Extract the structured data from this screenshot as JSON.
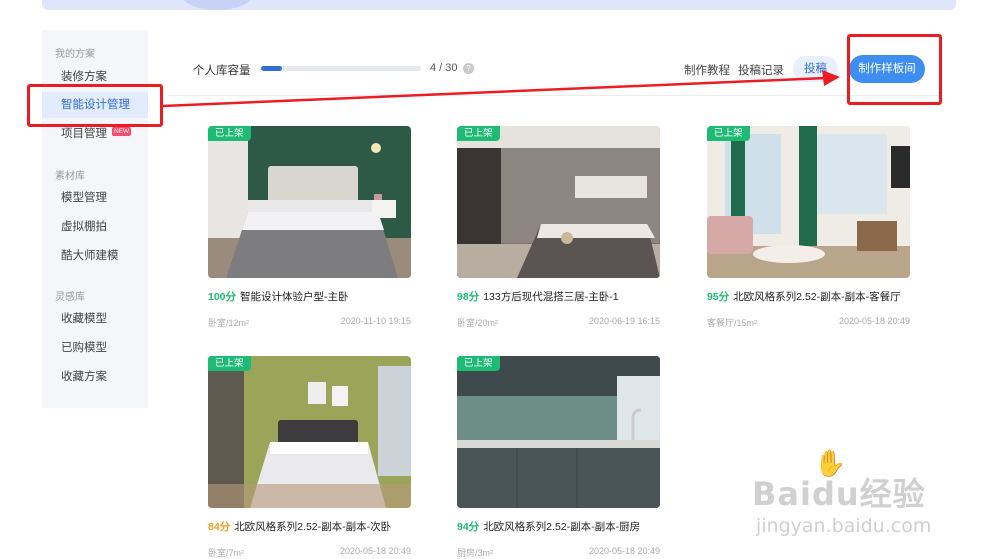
{
  "sidebar": {
    "groups": [
      {
        "title": "我的方案",
        "items": [
          "装修方案",
          "智能设计管理",
          "项目管理"
        ]
      },
      {
        "title": "素材库",
        "items": [
          "模型管理",
          "虚拟棚拍",
          "酷大师建模"
        ]
      },
      {
        "title": "灵感库",
        "items": [
          "收藏模型",
          "已购模型",
          "收藏方案"
        ]
      }
    ],
    "active_item": "智能设计管理",
    "new_badge": "NEW"
  },
  "header": {
    "capacity_label": "个人库容量",
    "capacity_used": 4,
    "capacity_total": 30,
    "capacity_text": "4 / 30",
    "help_icon": "?",
    "links": [
      "制作教程",
      "投稿记录"
    ],
    "submit_button": "投稿",
    "create_button": "制作样板间"
  },
  "cards": [
    {
      "tag": "已上架",
      "score": "100分",
      "score_color": "#1dbb73",
      "name": "智能设计体验户型-主卧",
      "room": "卧室/12m²",
      "date": "2020-11-10 19:15"
    },
    {
      "tag": "已上架",
      "score": "98分",
      "score_color": "#1dbb73",
      "name": "133方后现代混搭三居-主卧-1",
      "room": "卧室/20m²",
      "date": "2020-06-19 16:15"
    },
    {
      "tag": "已上架",
      "score": "95分",
      "score_color": "#1dbb73",
      "name": "北欧风格系列2.52-副本-副本-客餐厅",
      "room": "客餐厅/15m²",
      "date": "2020-05-18 20:49"
    },
    {
      "tag": "已上架",
      "score": "84分",
      "score_color": "#f0a020",
      "name": "北欧风格系列2.52-副本-副本-次卧",
      "room": "卧室/7m²",
      "date": "2020-05-18 20:49"
    },
    {
      "tag": "已上架",
      "score": "94分",
      "score_color": "#1dbb73",
      "name": "北欧风格系列2.52-副本-副本-厨房",
      "room": "厨房/3m²",
      "date": "2020-05-18 20:49"
    }
  ],
  "watermark": {
    "brand": "Baidu经验",
    "url": "jingyan.baidu.com"
  }
}
